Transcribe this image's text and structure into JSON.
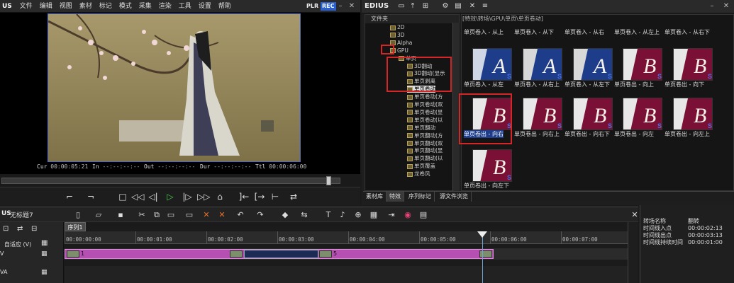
{
  "player": {
    "logo": "US",
    "menu": [
      "文件",
      "编辑",
      "视图",
      "素材",
      "标记",
      "模式",
      "采集",
      "渲染",
      "工具",
      "设置",
      "帮助"
    ],
    "plr": "PLR",
    "rec": "REC",
    "timecodes": {
      "cur_label": "Cur",
      "cur_value": "00:00:05:21",
      "in_label": "In",
      "in_value": "--:--:--:--",
      "out_label": "Out",
      "out_value": "--:--:--:--",
      "dur_label": "Dur",
      "dur_value": "--:--:--:--",
      "ttl_label": "Ttl",
      "ttl_value": "00:00:06:00"
    }
  },
  "edius_panel": {
    "title": "EDIUS",
    "tree_header": "文件夹",
    "tree": [
      {
        "label": "2D",
        "indent": 1
      },
      {
        "label": "3D",
        "indent": 1
      },
      {
        "label": "Alpha",
        "indent": 1
      },
      {
        "label": "GPU",
        "indent": 1,
        "selected": false
      },
      {
        "label": "单页",
        "indent": 2
      },
      {
        "label": "3D翻动",
        "indent": 3
      },
      {
        "label": "3D翻动(显示",
        "indent": 3
      },
      {
        "label": "单页剥离",
        "indent": 3
      },
      {
        "label": "单页卷动",
        "indent": 3,
        "selected": true
      },
      {
        "label": "单页卷动(方",
        "indent": 3
      },
      {
        "label": "单页卷动(双",
        "indent": 3
      },
      {
        "label": "单页卷动(显",
        "indent": 3
      },
      {
        "label": "单页卷动(以",
        "indent": 3
      },
      {
        "label": "单页翻动",
        "indent": 3
      },
      {
        "label": "单页翻动(方",
        "indent": 3
      },
      {
        "label": "单页翻动(双",
        "indent": 3
      },
      {
        "label": "单页翻动(显",
        "indent": 3
      },
      {
        "label": "单页翻动(以",
        "indent": 3
      },
      {
        "label": "单页覆盖",
        "indent": 3
      },
      {
        "label": "龙卷风",
        "indent": 3
      }
    ],
    "gallery_path": "[特效\\转场\\GPU\\单页\\单页卷动]",
    "top_captions": [
      "单页卷入 - 从上",
      "单页卷入 - 从下",
      "单页卷入 - 从右",
      "单页卷入 - 从左上",
      "单页卷入 - 从右下"
    ],
    "row1_captions": [
      "单页卷入 - 从左",
      "单页卷入 - 从右上",
      "单页卷入 - 从左下",
      "单页卷出 - 向上",
      "单页卷出 - 向下"
    ],
    "row2_captions": [
      "单页卷出 - 向右",
      "单页卷出 - 向右上",
      "单页卷出 - 向右下",
      "单页卷出 - 向左",
      "单页卷出 - 向左上"
    ],
    "row3_captions": [
      "单页卷出 - 向左下"
    ],
    "tabs": [
      "素材库",
      "特效",
      "序列标记",
      "源文件浏览"
    ]
  },
  "timeline": {
    "project_title": "无标题7",
    "sequence_tab": "序列1",
    "track_mode": "自适应 (V)",
    "ruler": [
      "00:00:00:00",
      "00:00:01:00",
      "00:00:02:00",
      "00:00:03:00",
      "00:00:04:00",
      "00:00:05:00",
      "00:00:06:00",
      "00:00:07:00"
    ],
    "track1_label": "V",
    "track2_label": "VA",
    "clip1_num": "1",
    "clip2_num": "5"
  },
  "info": {
    "rows": [
      {
        "k": "转场名称",
        "v": "翻转"
      },
      {
        "k": "时间线入点",
        "v": "00:00:02:13"
      },
      {
        "k": "时间线出点",
        "v": "00:00:03:13"
      },
      {
        "k": "时间线持续时间",
        "v": "00:00:01:00"
      }
    ]
  },
  "colors": {
    "accent_red": "#d42626",
    "clip": "#b54fb2",
    "thumb_blue": "#1d3c8a",
    "thumb_maroon": "#7a1036"
  }
}
